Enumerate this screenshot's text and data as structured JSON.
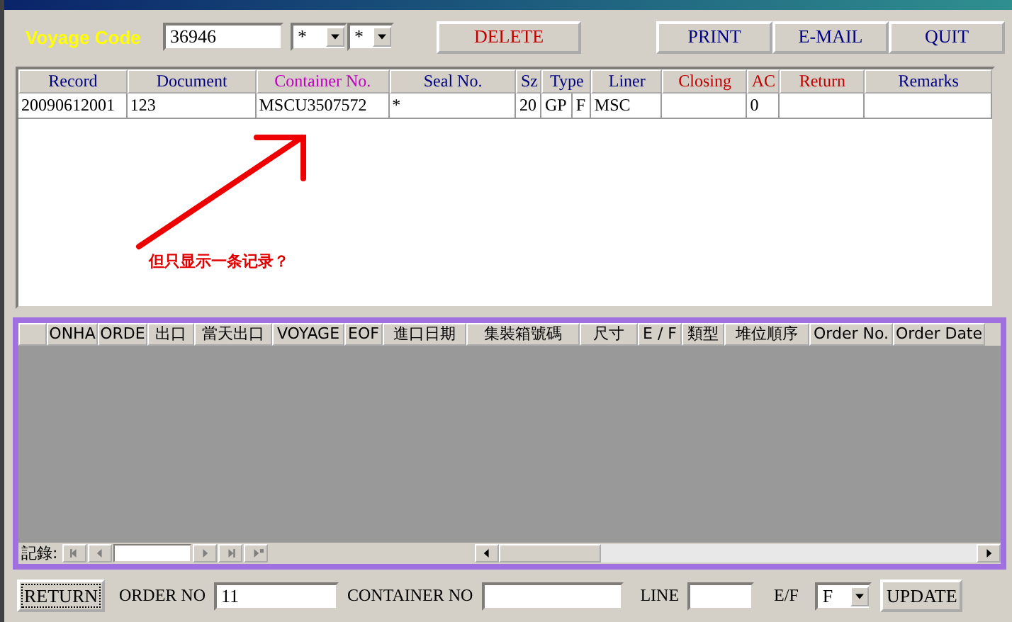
{
  "toolbar": {
    "voyage_label": "Voyage Code",
    "voyage_code": "36946",
    "filter_1": "*",
    "filter_2": "*",
    "buttons": [
      {
        "label": "DELETE",
        "kind": "danger"
      },
      {
        "label": "PRINT",
        "kind": "normal"
      },
      {
        "label": "E-MAIL",
        "kind": "normal"
      },
      {
        "label": "QUIT",
        "kind": "normal"
      }
    ]
  },
  "containers_table": {
    "columns": [
      {
        "label": "Record",
        "color": "#000080"
      },
      {
        "label": "Document",
        "color": "#000080"
      },
      {
        "label": "Container No.",
        "color": "#c000c0"
      },
      {
        "label": "Seal No.",
        "color": "#000080"
      },
      {
        "label": "Sz",
        "color": "#000080"
      },
      {
        "label": "Type",
        "color": "#000080"
      },
      {
        "label": "Liner",
        "color": "#000080"
      },
      {
        "label": "Closing",
        "color": "#c00000"
      },
      {
        "label": "AC",
        "color": "#c00000"
      },
      {
        "label": "Return",
        "color": "#c00000"
      },
      {
        "label": "Remarks",
        "color": "#000080"
      }
    ],
    "rows": [
      {
        "record": "20090612001",
        "document": "123",
        "container_no": "MSCU3507572",
        "seal_no": "*",
        "sz": "20",
        "type": "GP",
        "type_2": "F",
        "liner": "MSC",
        "ac": "0"
      }
    ]
  },
  "annotation": {
    "text": "但只显示一条记录？"
  },
  "orders_subform": {
    "columns": [
      "ONHA",
      "ORDE",
      "出口",
      "當天出口",
      "VOYAGE",
      "EOF",
      "進口日期",
      "集裝箱號碼",
      "尺寸",
      "E / F",
      "類型",
      "堆位順序",
      "Order No.",
      "Order Date"
    ],
    "navigation_label": "記錄:"
  },
  "footer": {
    "return_button": "RETURN",
    "order_no_label": "ORDER NO",
    "order_no": "11",
    "container_no_label": "CONTAINER NO",
    "line_label": "LINE",
    "ef_label": "E/F",
    "ef_value": "F",
    "update_button": "UPDATE"
  }
}
